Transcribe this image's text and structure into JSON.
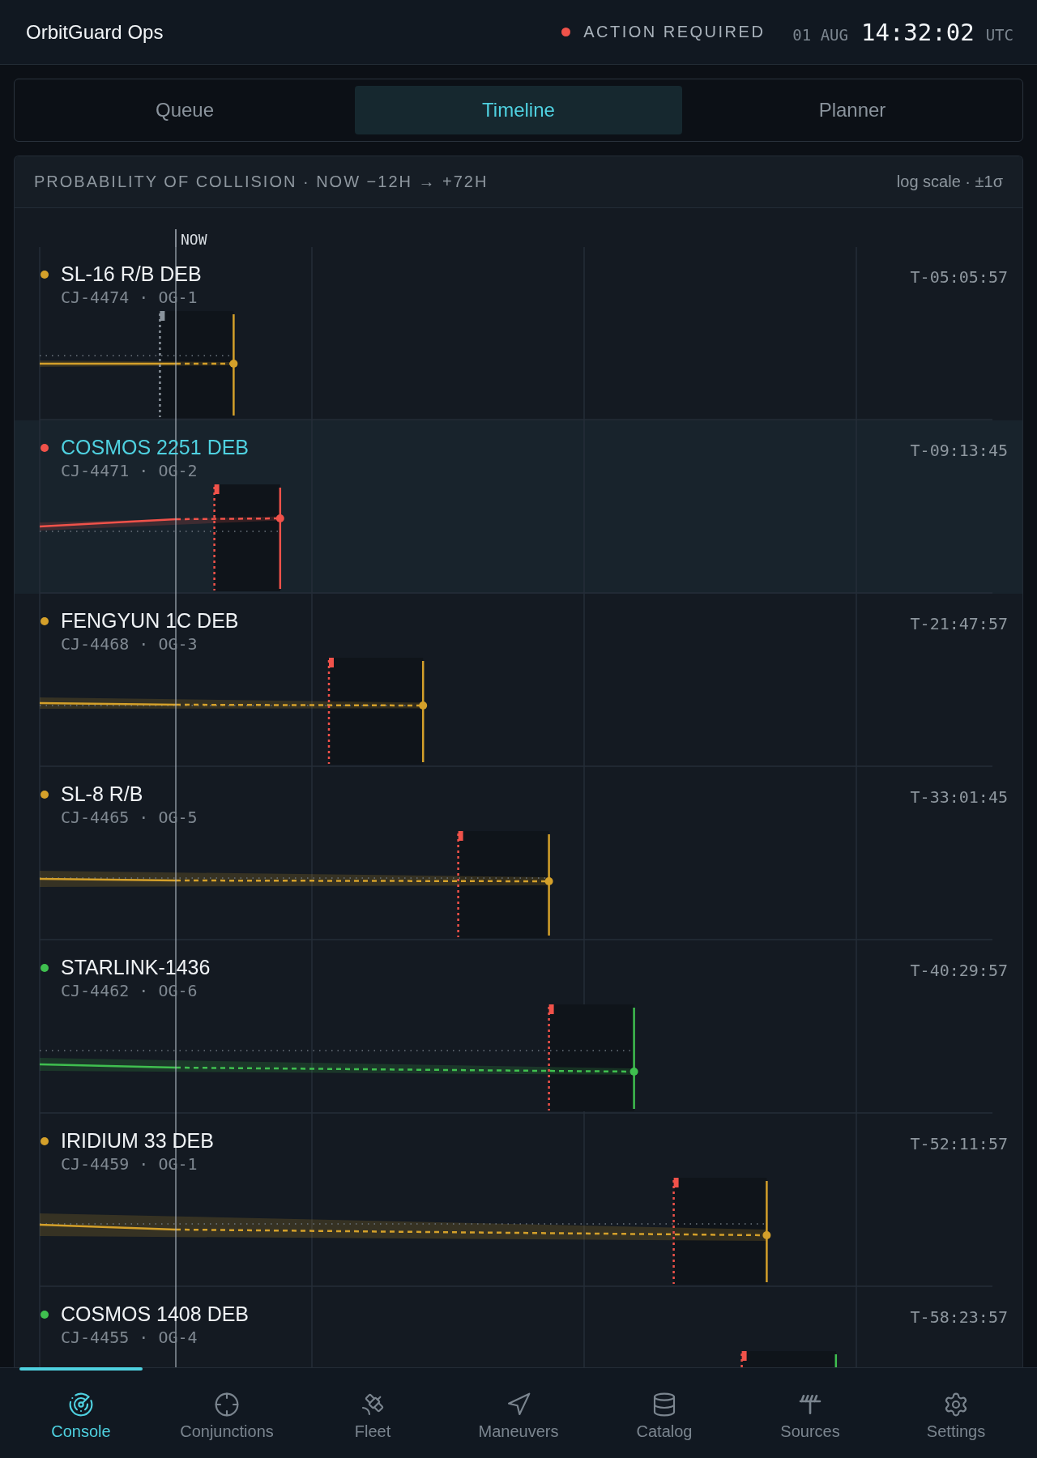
{
  "header": {
    "title": "OrbitGuard Ops",
    "alert": {
      "label": "ACTION REQUIRED",
      "color": "#f0524a"
    },
    "date": "01 AUG",
    "time": "14:32:02",
    "zone": "UTC"
  },
  "tabs": [
    {
      "label": "Queue",
      "selected": false
    },
    {
      "label": "Timeline",
      "selected": true
    },
    {
      "label": "Planner",
      "selected": false
    }
  ],
  "panel": {
    "title": "PROBABILITY OF COLLISION · NOW −12H → +72H",
    "legend": "log scale · ±1σ",
    "now_label": "NOW",
    "rows": [
      {
        "name": "SL-16 R/B DEB",
        "ids": "CJ-4474 · OG-1",
        "countdown": "T-05:05:57",
        "color": "#d4a02a",
        "selected": false
      },
      {
        "name": "COSMOS 2251 DEB",
        "ids": "CJ-4471 · OG-2",
        "countdown": "T-09:13:45",
        "color": "#f0524a",
        "selected": true
      },
      {
        "name": "FENGYUN 1C DEB",
        "ids": "CJ-4468 · OG-3",
        "countdown": "T-21:47:57",
        "color": "#d4a02a",
        "selected": false
      },
      {
        "name": "SL-8 R/B",
        "ids": "CJ-4465 · OG-5",
        "countdown": "T-33:01:45",
        "color": "#d4a02a",
        "selected": false
      },
      {
        "name": "STARLINK-1436",
        "ids": "CJ-4462 · OG-6",
        "countdown": "T-40:29:57",
        "color": "#3fbf4f",
        "selected": false
      },
      {
        "name": "IRIDIUM 33 DEB",
        "ids": "CJ-4459 · OG-1",
        "countdown": "T-52:11:57",
        "color": "#d4a02a",
        "selected": false
      },
      {
        "name": "COSMOS 1408 DEB",
        "ids": "CJ-4455 · OG-4",
        "countdown": "T-58:23:57",
        "color": "#3fbf4f",
        "selected": false
      }
    ]
  },
  "nav": [
    {
      "label": "Console",
      "selected": true
    },
    {
      "label": "Conjunctions",
      "selected": false
    },
    {
      "label": "Fleet",
      "selected": false
    },
    {
      "label": "Maneuvers",
      "selected": false
    },
    {
      "label": "Catalog",
      "selected": false
    },
    {
      "label": "Sources",
      "selected": false
    },
    {
      "label": "Settings",
      "selected": false
    }
  ]
}
